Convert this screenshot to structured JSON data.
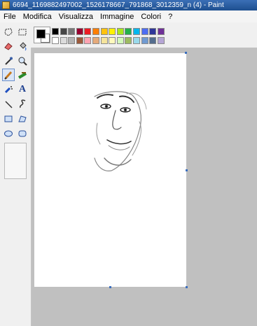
{
  "window": {
    "title": "6694_1169882497002_1526178667_791868_3012359_n (4) - Paint"
  },
  "menu": [
    "File",
    "Modifica",
    "Visualizza",
    "Immagine",
    "Colori",
    "?"
  ],
  "tools": [
    {
      "name": "free-select-icon"
    },
    {
      "name": "rect-select-icon"
    },
    {
      "name": "eraser-icon"
    },
    {
      "name": "fill-icon"
    },
    {
      "name": "color-picker-icon"
    },
    {
      "name": "magnifier-icon"
    },
    {
      "name": "pencil-icon",
      "selected": true
    },
    {
      "name": "brush-icon"
    },
    {
      "name": "airbrush-icon"
    },
    {
      "name": "text-icon",
      "glyph": "A"
    },
    {
      "name": "line-icon"
    },
    {
      "name": "curve-icon"
    },
    {
      "name": "rectangle-icon"
    },
    {
      "name": "polygon-icon"
    },
    {
      "name": "ellipse-icon"
    },
    {
      "name": "rounded-rect-icon"
    }
  ],
  "palette": {
    "foreground": "#000000",
    "background": "#ffffff",
    "top_row": [
      "#000000",
      "#464646",
      "#787878",
      "#990030",
      "#ed1c24",
      "#ff7e00",
      "#ffc20e",
      "#fff200",
      "#a8e61d",
      "#22b14c",
      "#00b7ef",
      "#4d6df3",
      "#2f3699",
      "#6f3198"
    ],
    "bottom_row": [
      "#ffffff",
      "#dcdcdc",
      "#b4b4b4",
      "#9c5a3c",
      "#ffa3b1",
      "#e5aa7a",
      "#f5e49c",
      "#fff9bd",
      "#d3f9bc",
      "#9dbb61",
      "#99d9ea",
      "#709ad1",
      "#546d8e",
      "#b5a5d5"
    ]
  },
  "canvas": {
    "content": "sketch-portrait-face"
  }
}
